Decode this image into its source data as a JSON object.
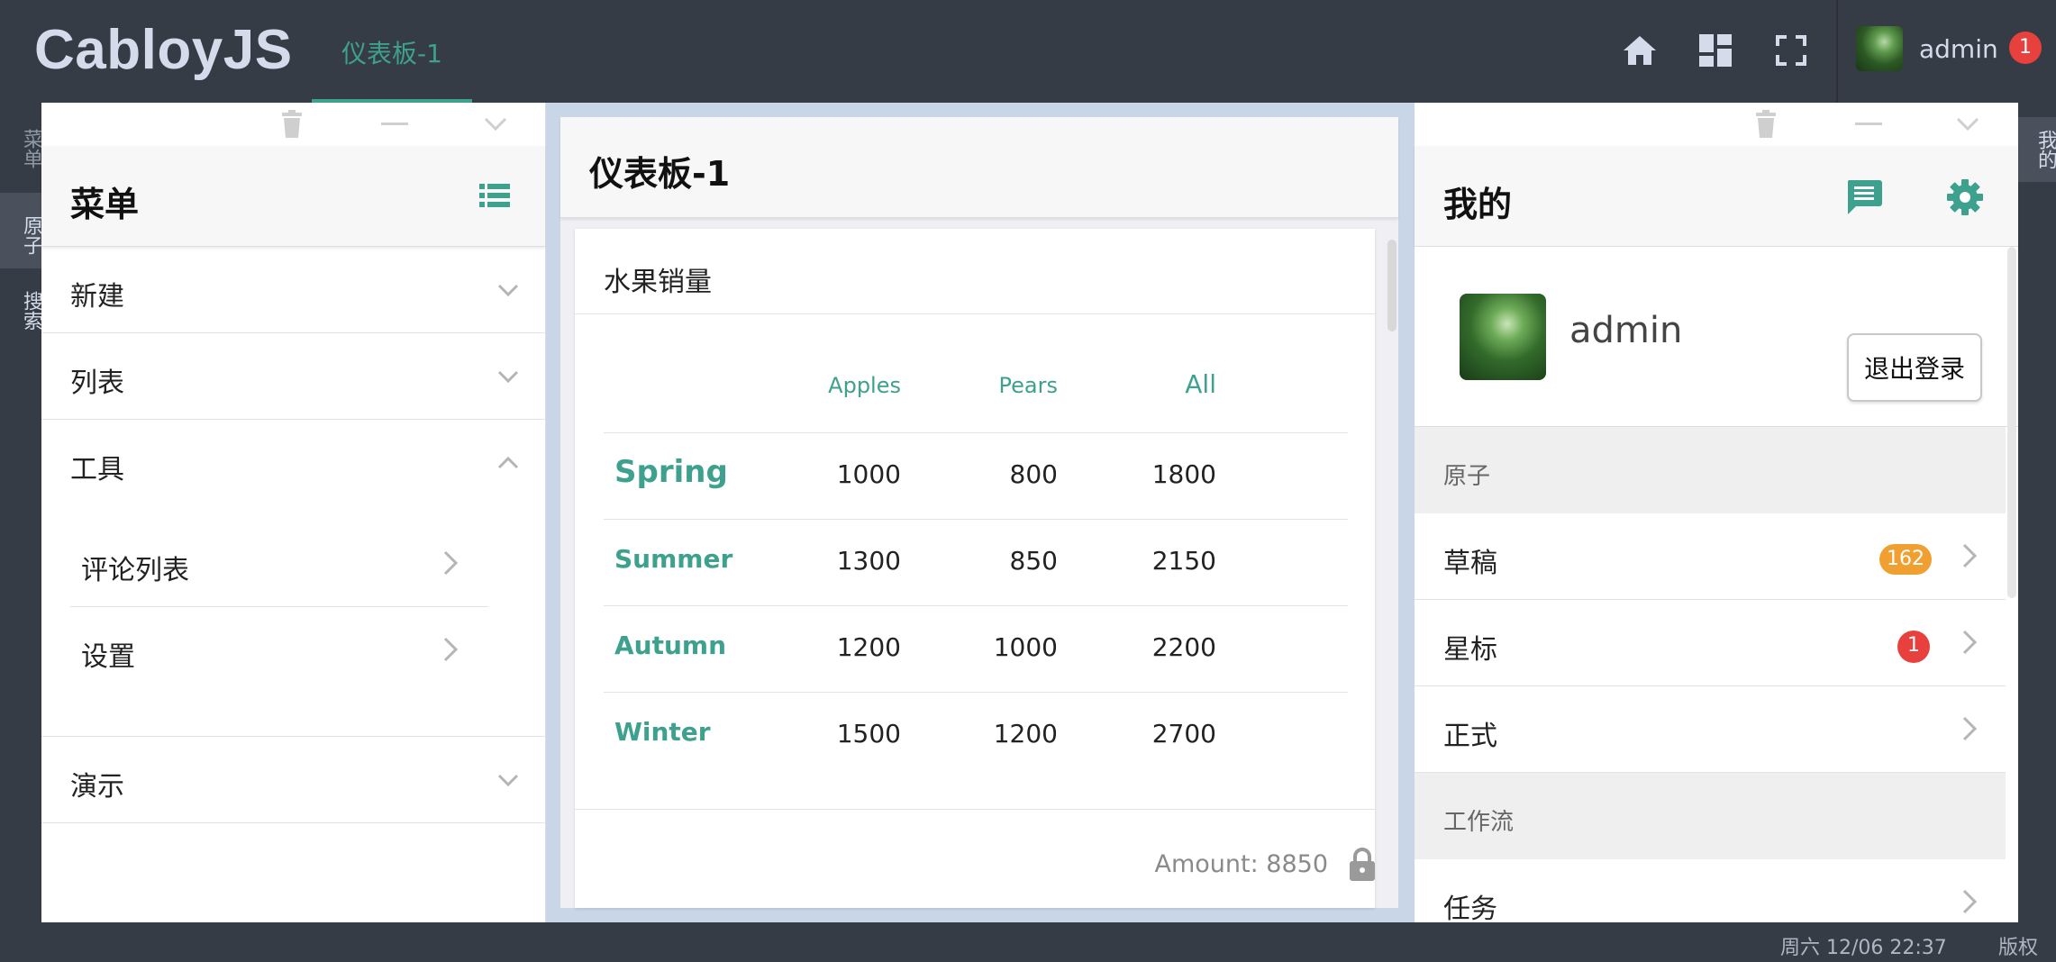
{
  "app": {
    "brand": "CabloyJS"
  },
  "top_tabs": [
    {
      "label": "仪表板-1"
    }
  ],
  "top_icons": [
    "home-icon",
    "dashboard-icon",
    "fullscreen-icon"
  ],
  "top_user": {
    "name": "admin",
    "badge": "1"
  },
  "left_vtabs": [
    {
      "label": "菜单"
    },
    {
      "label": "原子"
    },
    {
      "label": "搜索"
    }
  ],
  "right_vtabs": [
    {
      "label": "我的"
    }
  ],
  "menu_panel": {
    "title": "菜单",
    "items": [
      {
        "label": "新建",
        "expanded": false
      },
      {
        "label": "列表",
        "expanded": false
      },
      {
        "label": "工具",
        "expanded": true
      },
      {
        "label": "演示",
        "expanded": false
      }
    ],
    "tool_children": [
      {
        "label": "评论列表"
      },
      {
        "label": "设置"
      }
    ]
  },
  "dashboard": {
    "title": "仪表板-1",
    "card": {
      "title": "水果销量",
      "columns": [
        "Apples",
        "Pears",
        "All"
      ],
      "rows": [
        {
          "season": "Spring",
          "apples": "1000",
          "pears": "800",
          "all": "1800"
        },
        {
          "season": "Summer",
          "apples": "1300",
          "pears": "850",
          "all": "2150"
        },
        {
          "season": "Autumn",
          "apples": "1200",
          "pears": "1000",
          "all": "2200"
        },
        {
          "season": "Winter",
          "apples": "1500",
          "pears": "1200",
          "all": "2700"
        }
      ],
      "footer": "Amount: 8850"
    }
  },
  "mine_panel": {
    "title": "我的",
    "user": {
      "name": "admin",
      "logout_label": "退出登录"
    },
    "groups": [
      {
        "label": "原子",
        "items": [
          {
            "label": "草稿",
            "badge": "162",
            "badge_color": "#f0a030"
          },
          {
            "label": "星标",
            "badge": "1",
            "badge_color": "#e8403c"
          },
          {
            "label": "正式",
            "badge": ""
          }
        ]
      },
      {
        "label": "工作流",
        "items": [
          {
            "label": "任务",
            "badge": ""
          }
        ]
      }
    ]
  },
  "footer": {
    "datetime": "周六 12/06 22:37",
    "copyright": "版权"
  },
  "colors": {
    "accent": "#3ea18d",
    "topbar": "#363c45",
    "badge_red": "#e8403c",
    "badge_orange": "#f0a030"
  }
}
